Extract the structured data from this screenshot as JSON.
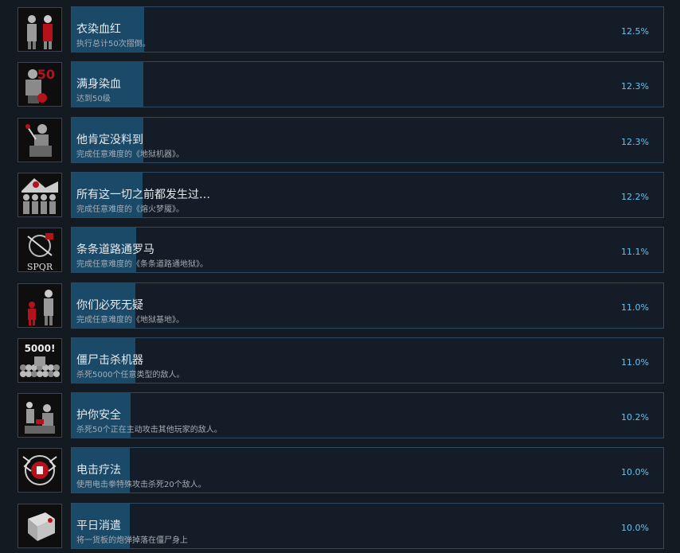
{
  "colors": {
    "background": "#131a22",
    "card_border": "#2c4a66",
    "progress_fill": "#1b4a69",
    "percent_text": "#66c0f4",
    "accent_red": "#b5121b"
  },
  "achievements": [
    {
      "name": "衣染血红",
      "desc": "执行总计50次摺倒。",
      "percent": "12.5%",
      "fill": 0.125,
      "icon": "two-zombies-icon"
    },
    {
      "name": "满身染血",
      "desc": "达到50级",
      "percent": "12.3%",
      "fill": 0.123,
      "icon": "level-50-icon",
      "icon_text": "50"
    },
    {
      "name": "他肯定没料到",
      "desc": "完成任意难度的《地狱机器》。",
      "percent": "12.3%",
      "fill": 0.123,
      "icon": "stabbing-zombie-icon"
    },
    {
      "name": "所有这一切之前都发生过…",
      "desc": "完成任意难度的《熔火梦魇》。",
      "percent": "12.2%",
      "fill": 0.122,
      "icon": "zombie-horde-icon"
    },
    {
      "name": "条条道路通罗马",
      "desc": "完成任意难度的《条条道路通地狱》。",
      "percent": "11.1%",
      "fill": 0.111,
      "icon": "spqr-icon",
      "icon_text": "SPQR"
    },
    {
      "name": "你们必死无疑",
      "desc": "完成任意难度的《地狱基地》。",
      "percent": "11.0%",
      "fill": 0.11,
      "icon": "red-figure-zombie-icon"
    },
    {
      "name": "僵尸击杀机器",
      "desc": "杀死5000个任意类型的敌人。",
      "percent": "11.0%",
      "fill": 0.11,
      "icon": "5000-skulls-icon",
      "icon_text": "5000!"
    },
    {
      "name": "护你安全",
      "desc": "杀死50个正在主动攻击其他玩家的敌人。",
      "percent": "10.2%",
      "fill": 0.102,
      "icon": "rescue-icon"
    },
    {
      "name": "电击疗法",
      "desc": "使用电击拳特殊攻击杀死20个敌人。",
      "percent": "10.0%",
      "fill": 0.1,
      "icon": "electric-fist-icon"
    },
    {
      "name": "平日消遣",
      "desc": "将一货板的炮弹掉落在僵尸身上",
      "percent": "10.0%",
      "fill": 0.1,
      "icon": "pallet-crate-icon"
    }
  ]
}
